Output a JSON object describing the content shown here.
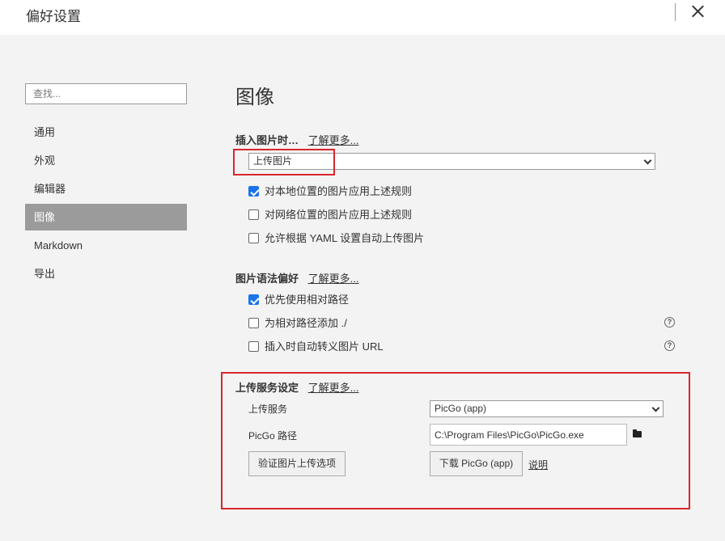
{
  "window": {
    "title": "偏好设置"
  },
  "search": {
    "placeholder": "查找..."
  },
  "sidebar": {
    "items": [
      {
        "label": "通用"
      },
      {
        "label": "外观"
      },
      {
        "label": "编辑器"
      },
      {
        "label": "图像",
        "active": true
      },
      {
        "label": "Markdown"
      },
      {
        "label": "导出"
      }
    ]
  },
  "main": {
    "title": "图像",
    "insert_section": {
      "title": "插入图片时…",
      "learn_more": "了解更多...",
      "selected": "上传图片",
      "options": [
        {
          "label": "对本地位置的图片应用上述规则",
          "checked": true
        },
        {
          "label": "对网络位置的图片应用上述规则",
          "checked": false
        },
        {
          "label": "允许根据 YAML 设置自动上传图片",
          "checked": false
        }
      ]
    },
    "syntax_section": {
      "title": "图片语法偏好",
      "learn_more": "了解更多...",
      "options": [
        {
          "label": "优先使用相对路径",
          "checked": true
        },
        {
          "label": "为相对路径添加 ./",
          "checked": false,
          "help": true
        },
        {
          "label": "插入时自动转义图片 URL",
          "checked": false,
          "help": true
        }
      ]
    },
    "upload_section": {
      "title": "上传服务设定",
      "learn_more": "了解更多...",
      "service_label": "上传服务",
      "service_selected": "PicGo (app)",
      "path_label": "PicGo 路径",
      "path_value": "C:\\Program Files\\PicGo\\PicGo.exe",
      "verify_button": "验证图片上传选项",
      "download_button": "下载 PicGo (app)",
      "help_link": "说明"
    }
  },
  "colors": {
    "accent": "#1a73e8",
    "highlight": "#d9262c",
    "active_nav": "#9b9b9b"
  },
  "icons": {
    "close": "close-icon",
    "help": "help-circle-icon",
    "folder": "folder-icon",
    "caret": "chevron-down-icon"
  }
}
